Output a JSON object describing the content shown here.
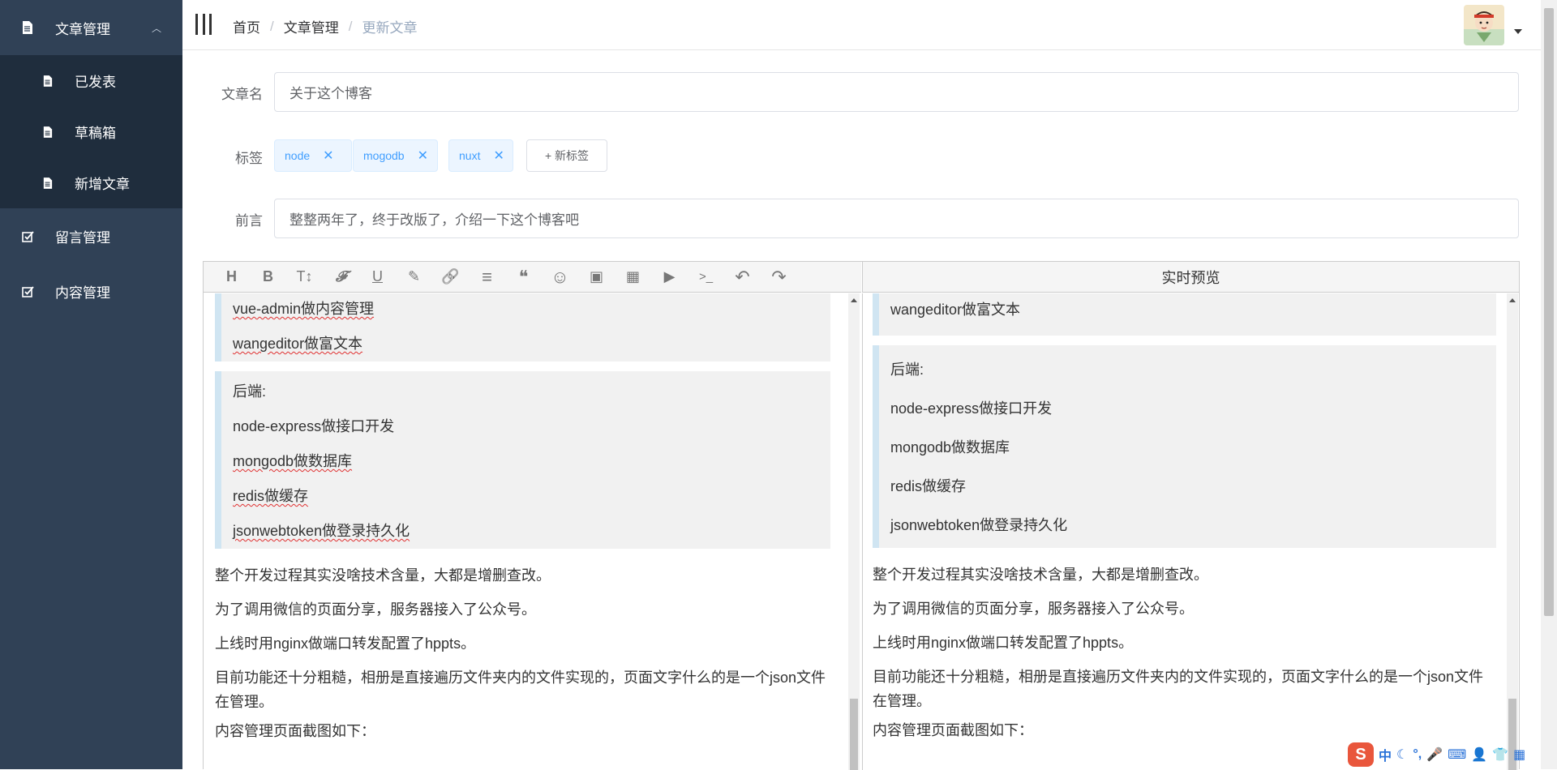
{
  "sidebar": {
    "article_menu": "文章管理",
    "sub_items": [
      "已发表",
      "草稿箱",
      "新增文章"
    ],
    "comment_menu": "留言管理",
    "content_menu": "内容管理"
  },
  "breadcrumb": [
    "首页",
    "文章管理",
    "更新文章"
  ],
  "form": {
    "title_label": "文章名",
    "title_value": "关于这个博客",
    "tags_label": "标签",
    "tags": [
      "node",
      "mogodb",
      "nuxt"
    ],
    "tag_close_glyph": "✕",
    "new_tag_label": "+ 新标签",
    "preface_label": "前言",
    "preface_value": "整整两年了，终于改版了，介绍一下这个博客吧"
  },
  "editor": {
    "preview_title": "实时预览",
    "toolbar_icons": [
      "heading-icon",
      "bold-icon",
      "font-size-icon",
      "font-family-icon",
      "underline-icon",
      "brush-icon",
      "link-icon",
      "align-icon",
      "quote-icon",
      "emoji-icon",
      "image-icon",
      "table-icon",
      "video-icon",
      "code-icon",
      "undo-icon",
      "redo-icon"
    ],
    "toolbar_glyphs": [
      "H",
      "B",
      "T↕",
      "𝓕",
      "U",
      "✎",
      "🔗",
      "≡",
      "❝",
      "☺",
      "▣",
      "▦",
      "▶",
      ">_",
      "↶",
      "↷"
    ],
    "left": {
      "block1": [
        "vue-admin做内容管理",
        "wangeditor做富文本"
      ],
      "block2": [
        "后端:",
        "node-express做接口开发",
        "mongodb做数据库",
        "redis做缓存",
        "jsonwebtoken做登录持久化"
      ],
      "paragraphs": [
        "整个开发过程其实没啥技术含量，大都是增删查改。",
        "为了调用微信的页面分享，服务器接入了公众号。",
        "上线时用nginx做端口转发配置了hppts。",
        "目前功能还十分粗糙，相册是直接遍历文件夹内的文件实现的，页面文字什么的是一个json文件在管理。",
        "内容管理页面截图如下："
      ]
    },
    "right": {
      "block1": [
        "wangeditor做富文本"
      ],
      "block2": [
        "后端:",
        "node-express做接口开发",
        "mongodb做数据库",
        "redis做缓存",
        "jsonwebtoken做登录持久化"
      ],
      "paragraphs": [
        "整个开发过程其实没啥技术含量，大都是增删查改。",
        "为了调用微信的页面分享，服务器接入了公众号。",
        "上线时用nginx做端口转发配置了hppts。",
        "目前功能还十分粗糙，相册是直接遍历文件夹内的文件实现的，页面文字什么的是一个json文件在管理。",
        "内容管理页面截图如下："
      ]
    }
  },
  "ime": {
    "logo": "S",
    "mode": "中",
    "icons": [
      "moon-icon",
      "punctuation-icon",
      "mic-icon",
      "keyboard-icon",
      "skin-icon",
      "shirt-icon",
      "grid-icon"
    ],
    "glyphs": [
      "☾",
      "°,",
      "🎤",
      "⌨",
      "👤",
      "👕",
      "▦"
    ]
  },
  "colors": {
    "sidebar_bg": "#304156",
    "submenu_bg": "#1f2d3d",
    "tag_text": "#409eff",
    "quote_border": "#d0e5f2"
  }
}
